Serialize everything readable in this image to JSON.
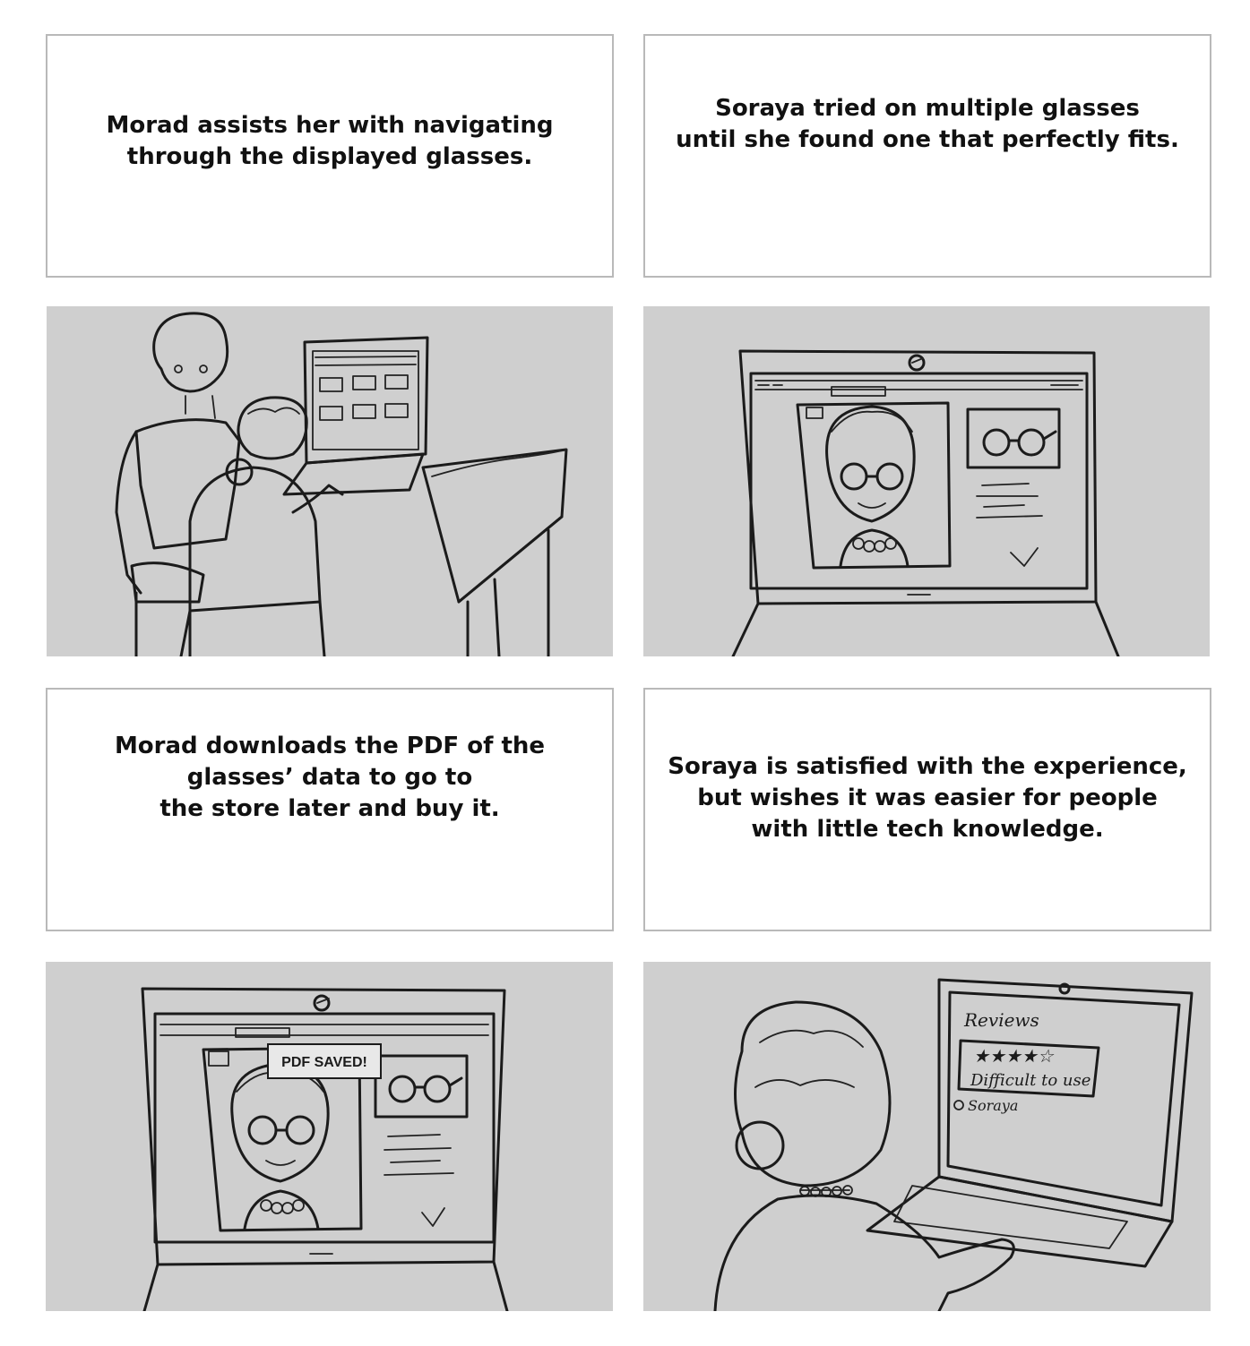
{
  "captions": {
    "panel_1": "Morad assists her with navigating\nthrough the displayed glasses.",
    "panel_2": "Soraya tried on multiple glasses\nuntil she found one that perfectly fits.",
    "panel_3": "Morad downloads the PDF of the\nglasses’ data to go to\nthe store later and buy it.",
    "panel_4": "Soraya is satisfied with the experience,\nbut wishes it was easier for people\nwith little tech knowledge."
  },
  "sketch_text": {
    "pdf_popup": "PDF SAVED!",
    "reviews_title": "Reviews",
    "review_comment": "Difficult to use",
    "reviewer": "Soraya"
  },
  "colors": {
    "caption_border": "#b9b9b9",
    "sketch_paper": "#cfcfcf",
    "ink": "#1b1b1b"
  }
}
